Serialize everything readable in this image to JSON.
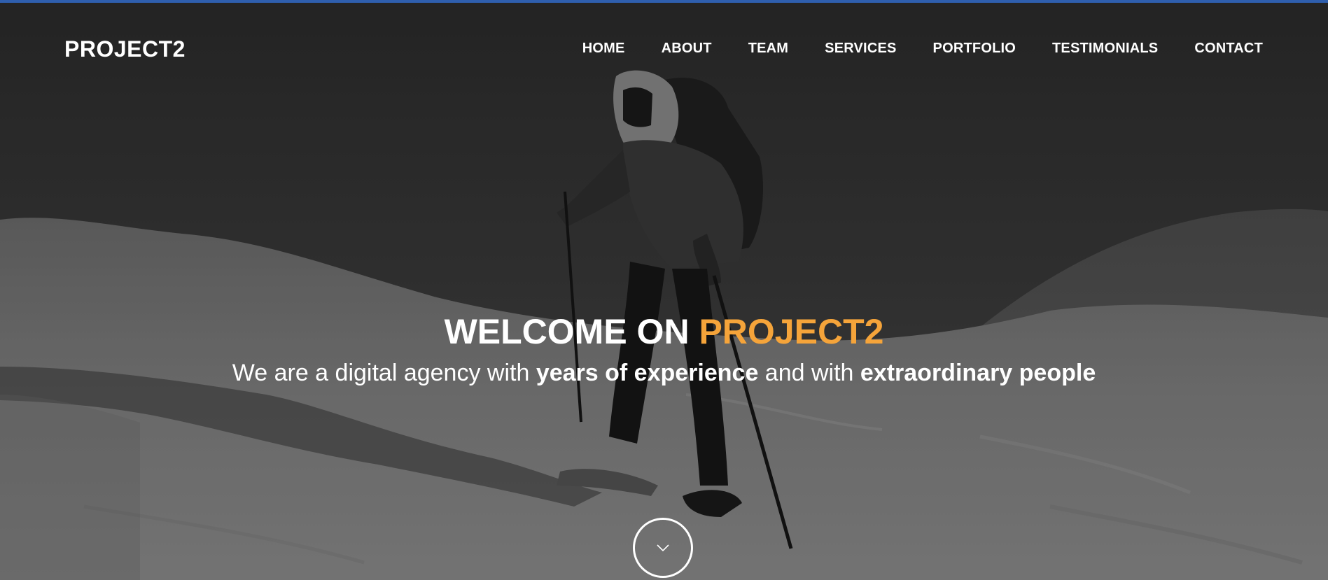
{
  "brand": {
    "name": "PROJECT2"
  },
  "nav": {
    "items": [
      {
        "label": "HOME"
      },
      {
        "label": "ABOUT"
      },
      {
        "label": "TEAM"
      },
      {
        "label": "SERVICES"
      },
      {
        "label": "PORTFOLIO"
      },
      {
        "label": "TESTIMONIALS"
      },
      {
        "label": "CONTACT"
      }
    ]
  },
  "hero": {
    "headline_prefix": "WELCOME ON ",
    "headline_accent": "PROJECT2",
    "tagline_part1": "We are a digital agency with ",
    "tagline_bold1": "years of experience",
    "tagline_part2": " and with ",
    "tagline_bold2": "extraordinary people",
    "scroll_icon": "chevron-down-icon"
  },
  "colors": {
    "accent": "#f5a43a",
    "top_bar": "#2f5fae",
    "text": "#ffffff"
  }
}
